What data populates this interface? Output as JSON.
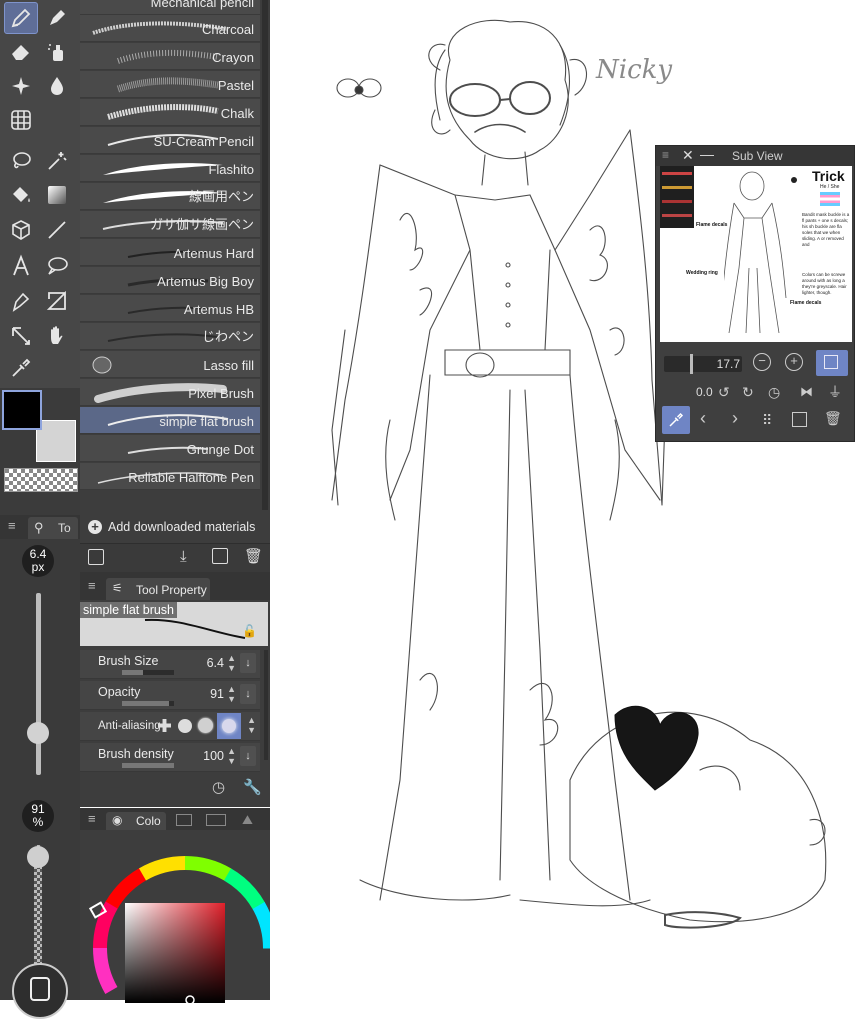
{
  "tool_icons": [
    "pen-icon",
    "marker-icon",
    "eraser-icon",
    "airbrush-icon",
    "decoration-icon",
    "blend-icon",
    "grid-icon",
    "lasso-icon",
    "magic-wand-icon",
    "fill-icon",
    "gradient-icon",
    "3d-cube-icon",
    "line-icon",
    "text-icon",
    "balloon-icon",
    "vector-pen-icon",
    "frame-icon",
    "move-icon",
    "hand-icon",
    "eyedropper-icon"
  ],
  "brushes": [
    {
      "label": "Mechanical pencil"
    },
    {
      "label": "Charcoal"
    },
    {
      "label": "Crayon"
    },
    {
      "label": "Pastel"
    },
    {
      "label": "Chalk"
    },
    {
      "label": "SU-Cream Pencil"
    },
    {
      "label": "Flashito"
    },
    {
      "label": "線画用ペン"
    },
    {
      "label": "ガサ伽サ線画ペン"
    },
    {
      "label": "Artemus Hard"
    },
    {
      "label": "Artemus Big Boy"
    },
    {
      "label": "Artemus HB"
    },
    {
      "label": "じわペン"
    },
    {
      "label": "Lasso fill"
    },
    {
      "label": "Pixel Brush"
    },
    {
      "label": "simple flat brush"
    },
    {
      "label": "Grunge Dot"
    },
    {
      "label": "Reliable Halftone Pen"
    }
  ],
  "add_materials_label": "Add downloaded materials",
  "side_tab_label": "To",
  "brush_size_badge": {
    "value": "6.4",
    "unit": "px"
  },
  "opacity_badge": {
    "value": "91",
    "unit": "%"
  },
  "brush_size_slider_level": 0.23,
  "opacity_slider_level": 0.91,
  "tool_property": {
    "tab_label": "Tool Property",
    "preview_name": "simple flat brush",
    "rows": [
      {
        "label": "Brush Size",
        "value": "6.4",
        "level": 0.4
      },
      {
        "label": "Opacity",
        "value": "91",
        "level": 0.91
      },
      {
        "label": "Anti-aliasing",
        "value": ""
      },
      {
        "label": "Brush density",
        "value": "100",
        "level": 1.0
      }
    ]
  },
  "color_tab_label": "Colo",
  "colors": {
    "main": "#000000",
    "sub": "#d4d4d4",
    "accent": "#6f85c5",
    "panel": "#3d3d3d"
  },
  "canvas": {
    "signature": "Nicky"
  },
  "subview": {
    "title": "Sub View",
    "zoom": "17.7",
    "rotation": "0.0",
    "thumb_text": {
      "heading": "Trick",
      "pronouns": "He / She",
      "flame_decals_1": "Flame decals",
      "wedding_ring": "Wedding ring",
      "flame_decals_2": "Flame decals",
      "desc1": "Bandit mask buckle is a fl pants + one s decals; his sh buckle are fla soles that we when sliding. A or removed and",
      "desc2": "Colors can be screwe around with as long a they're greyscale. Hair lighter, though."
    }
  }
}
